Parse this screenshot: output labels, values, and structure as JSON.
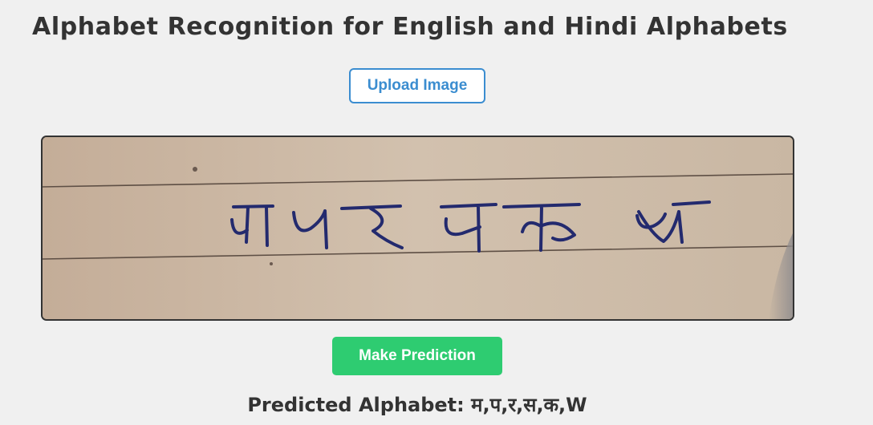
{
  "page": {
    "title": "Alphabet Recognition for English and Hindi Alphabets"
  },
  "upload": {
    "label": "Upload Image"
  },
  "preview": {
    "handwritten_characters": [
      "म",
      "प",
      "र",
      "स",
      "क",
      "W"
    ]
  },
  "predict": {
    "label": "Make Prediction"
  },
  "result": {
    "label": "Predicted Alphabet:",
    "value": "म,प,र,स,क,W"
  },
  "colors": {
    "background": "#f0f0f0",
    "text": "#333333",
    "upload_accent": "#3b8dd0",
    "predict_button": "#2ecc71",
    "paper": "#cbb8a4",
    "ink": "#232a6e"
  }
}
